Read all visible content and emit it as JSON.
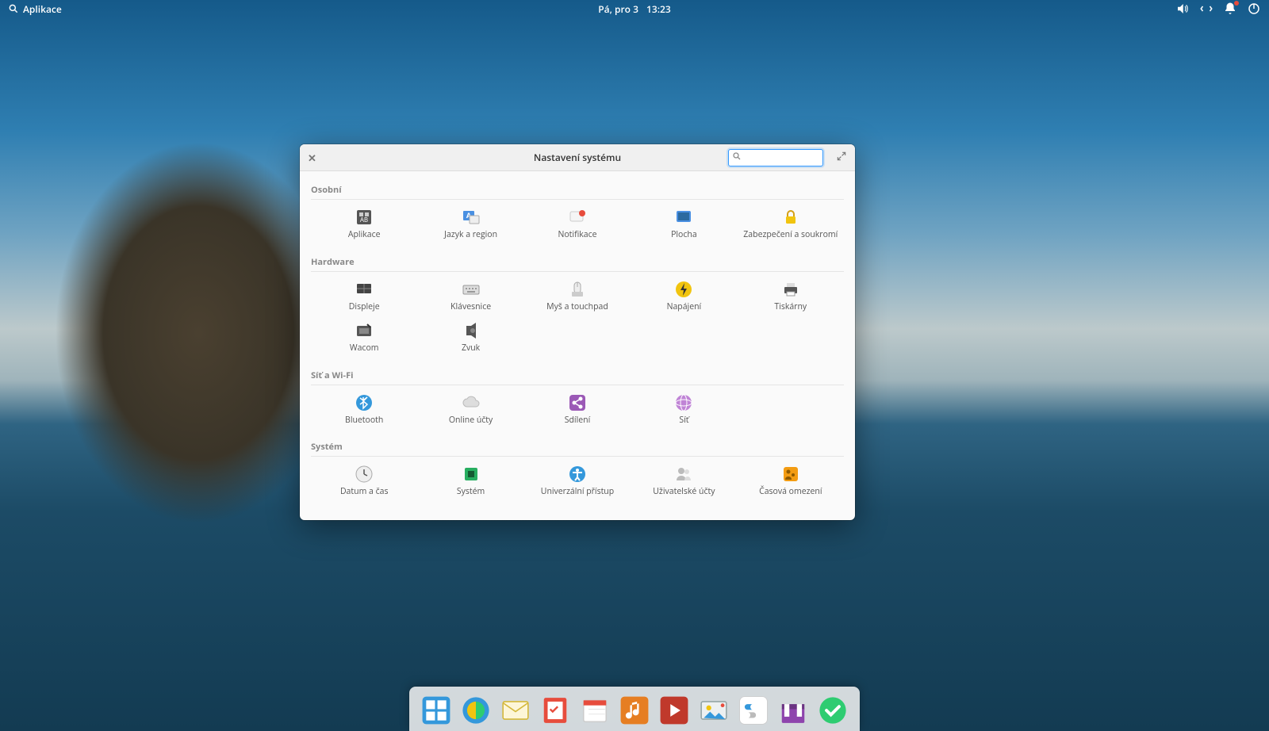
{
  "panel": {
    "applications_label": "Aplikace",
    "date": "Pá, pro 3",
    "time": "13:23"
  },
  "window": {
    "title": "Nastavení systému",
    "search_placeholder": ""
  },
  "sections": {
    "personal": {
      "title": "Osobní",
      "items": [
        {
          "id": "apps",
          "label": "Aplikace"
        },
        {
          "id": "lang",
          "label": "Jazyk a region"
        },
        {
          "id": "notif",
          "label": "Notifikace"
        },
        {
          "id": "desktop",
          "label": "Plocha"
        },
        {
          "id": "privacy",
          "label": "Zabezpečení a soukromí"
        }
      ]
    },
    "hardware": {
      "title": "Hardware",
      "items": [
        {
          "id": "display",
          "label": "Displeje"
        },
        {
          "id": "keyboard",
          "label": "Klávesnice"
        },
        {
          "id": "mouse",
          "label": "Myš a touchpad"
        },
        {
          "id": "power",
          "label": "Napájení"
        },
        {
          "id": "printer",
          "label": "Tiskárny"
        },
        {
          "id": "wacom",
          "label": "Wacom"
        },
        {
          "id": "sound",
          "label": "Zvuk"
        }
      ]
    },
    "network": {
      "title": "Síť a Wi-Fi",
      "items": [
        {
          "id": "bluetooth",
          "label": "Bluetooth"
        },
        {
          "id": "online",
          "label": "Online účty"
        },
        {
          "id": "sharing",
          "label": "Sdílení"
        },
        {
          "id": "net",
          "label": "Síť"
        }
      ]
    },
    "system": {
      "title": "Systém",
      "items": [
        {
          "id": "datetime",
          "label": "Datum a čas"
        },
        {
          "id": "system",
          "label": "Systém"
        },
        {
          "id": "a11y",
          "label": "Univerzální přístup"
        },
        {
          "id": "users",
          "label": "Uživatelské účty"
        },
        {
          "id": "time-limits",
          "label": "Časová omezení"
        }
      ]
    }
  },
  "dock": {
    "items": [
      {
        "id": "multitask",
        "name": "multitask-icon"
      },
      {
        "id": "browser",
        "name": "browser-icon"
      },
      {
        "id": "mail",
        "name": "mail-icon"
      },
      {
        "id": "tasks",
        "name": "tasks-icon"
      },
      {
        "id": "calendar",
        "name": "calendar-icon"
      },
      {
        "id": "music",
        "name": "music-icon"
      },
      {
        "id": "videos",
        "name": "videos-icon"
      },
      {
        "id": "photos",
        "name": "photos-icon"
      },
      {
        "id": "settings",
        "name": "settings-icon"
      },
      {
        "id": "appcenter",
        "name": "appcenter-icon"
      },
      {
        "id": "done",
        "name": "installer-icon"
      }
    ]
  }
}
